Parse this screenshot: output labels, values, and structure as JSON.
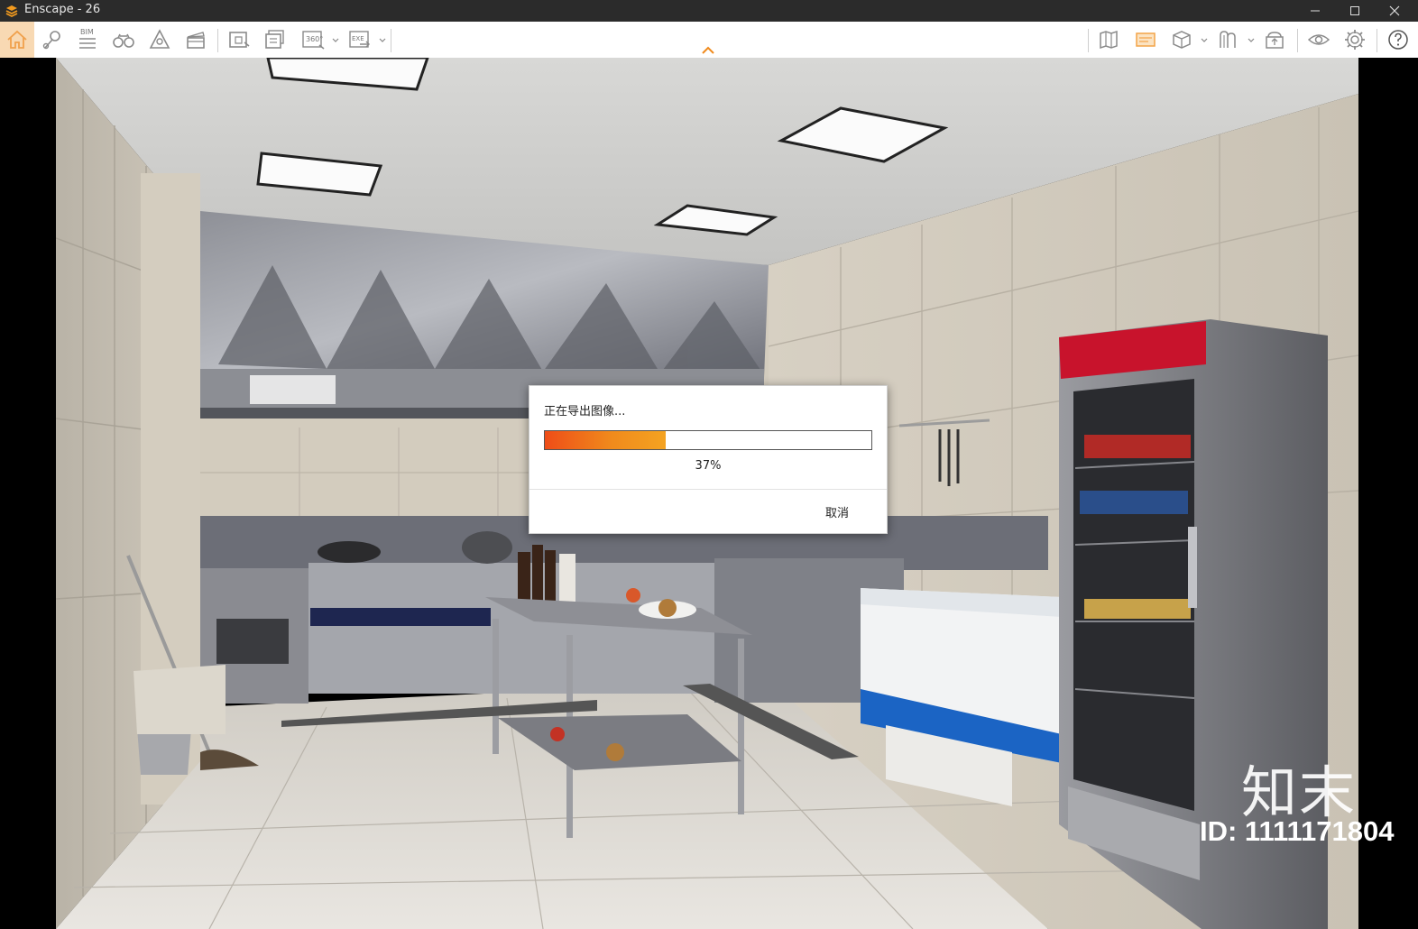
{
  "window": {
    "title": "Enscape - 26"
  },
  "toolbar": {
    "left_icons": [
      "home-icon",
      "location-pin-icon",
      "bim-icon",
      "binoculars-icon",
      "visual-settings-icon",
      "video-editor-icon",
      "screenshot-icon",
      "batch-render-icon",
      "panorama-360-icon",
      "export-exe-icon"
    ],
    "bim_label": "BIM",
    "panorama_label": "360°",
    "exe_label": "EXE",
    "right_icons": [
      "map-icon",
      "render-settings-icon",
      "asset-library-icon",
      "material-icon",
      "upload-icon",
      "view-icon",
      "settings-icon",
      "help-icon"
    ]
  },
  "dialog": {
    "title": "正在导出图像...",
    "progress": 0.37,
    "percent_text": "37%",
    "cancel_label": "取消"
  },
  "scene": {
    "watermark_logo": "知末",
    "watermark_id": "ID: 1111171804"
  }
}
